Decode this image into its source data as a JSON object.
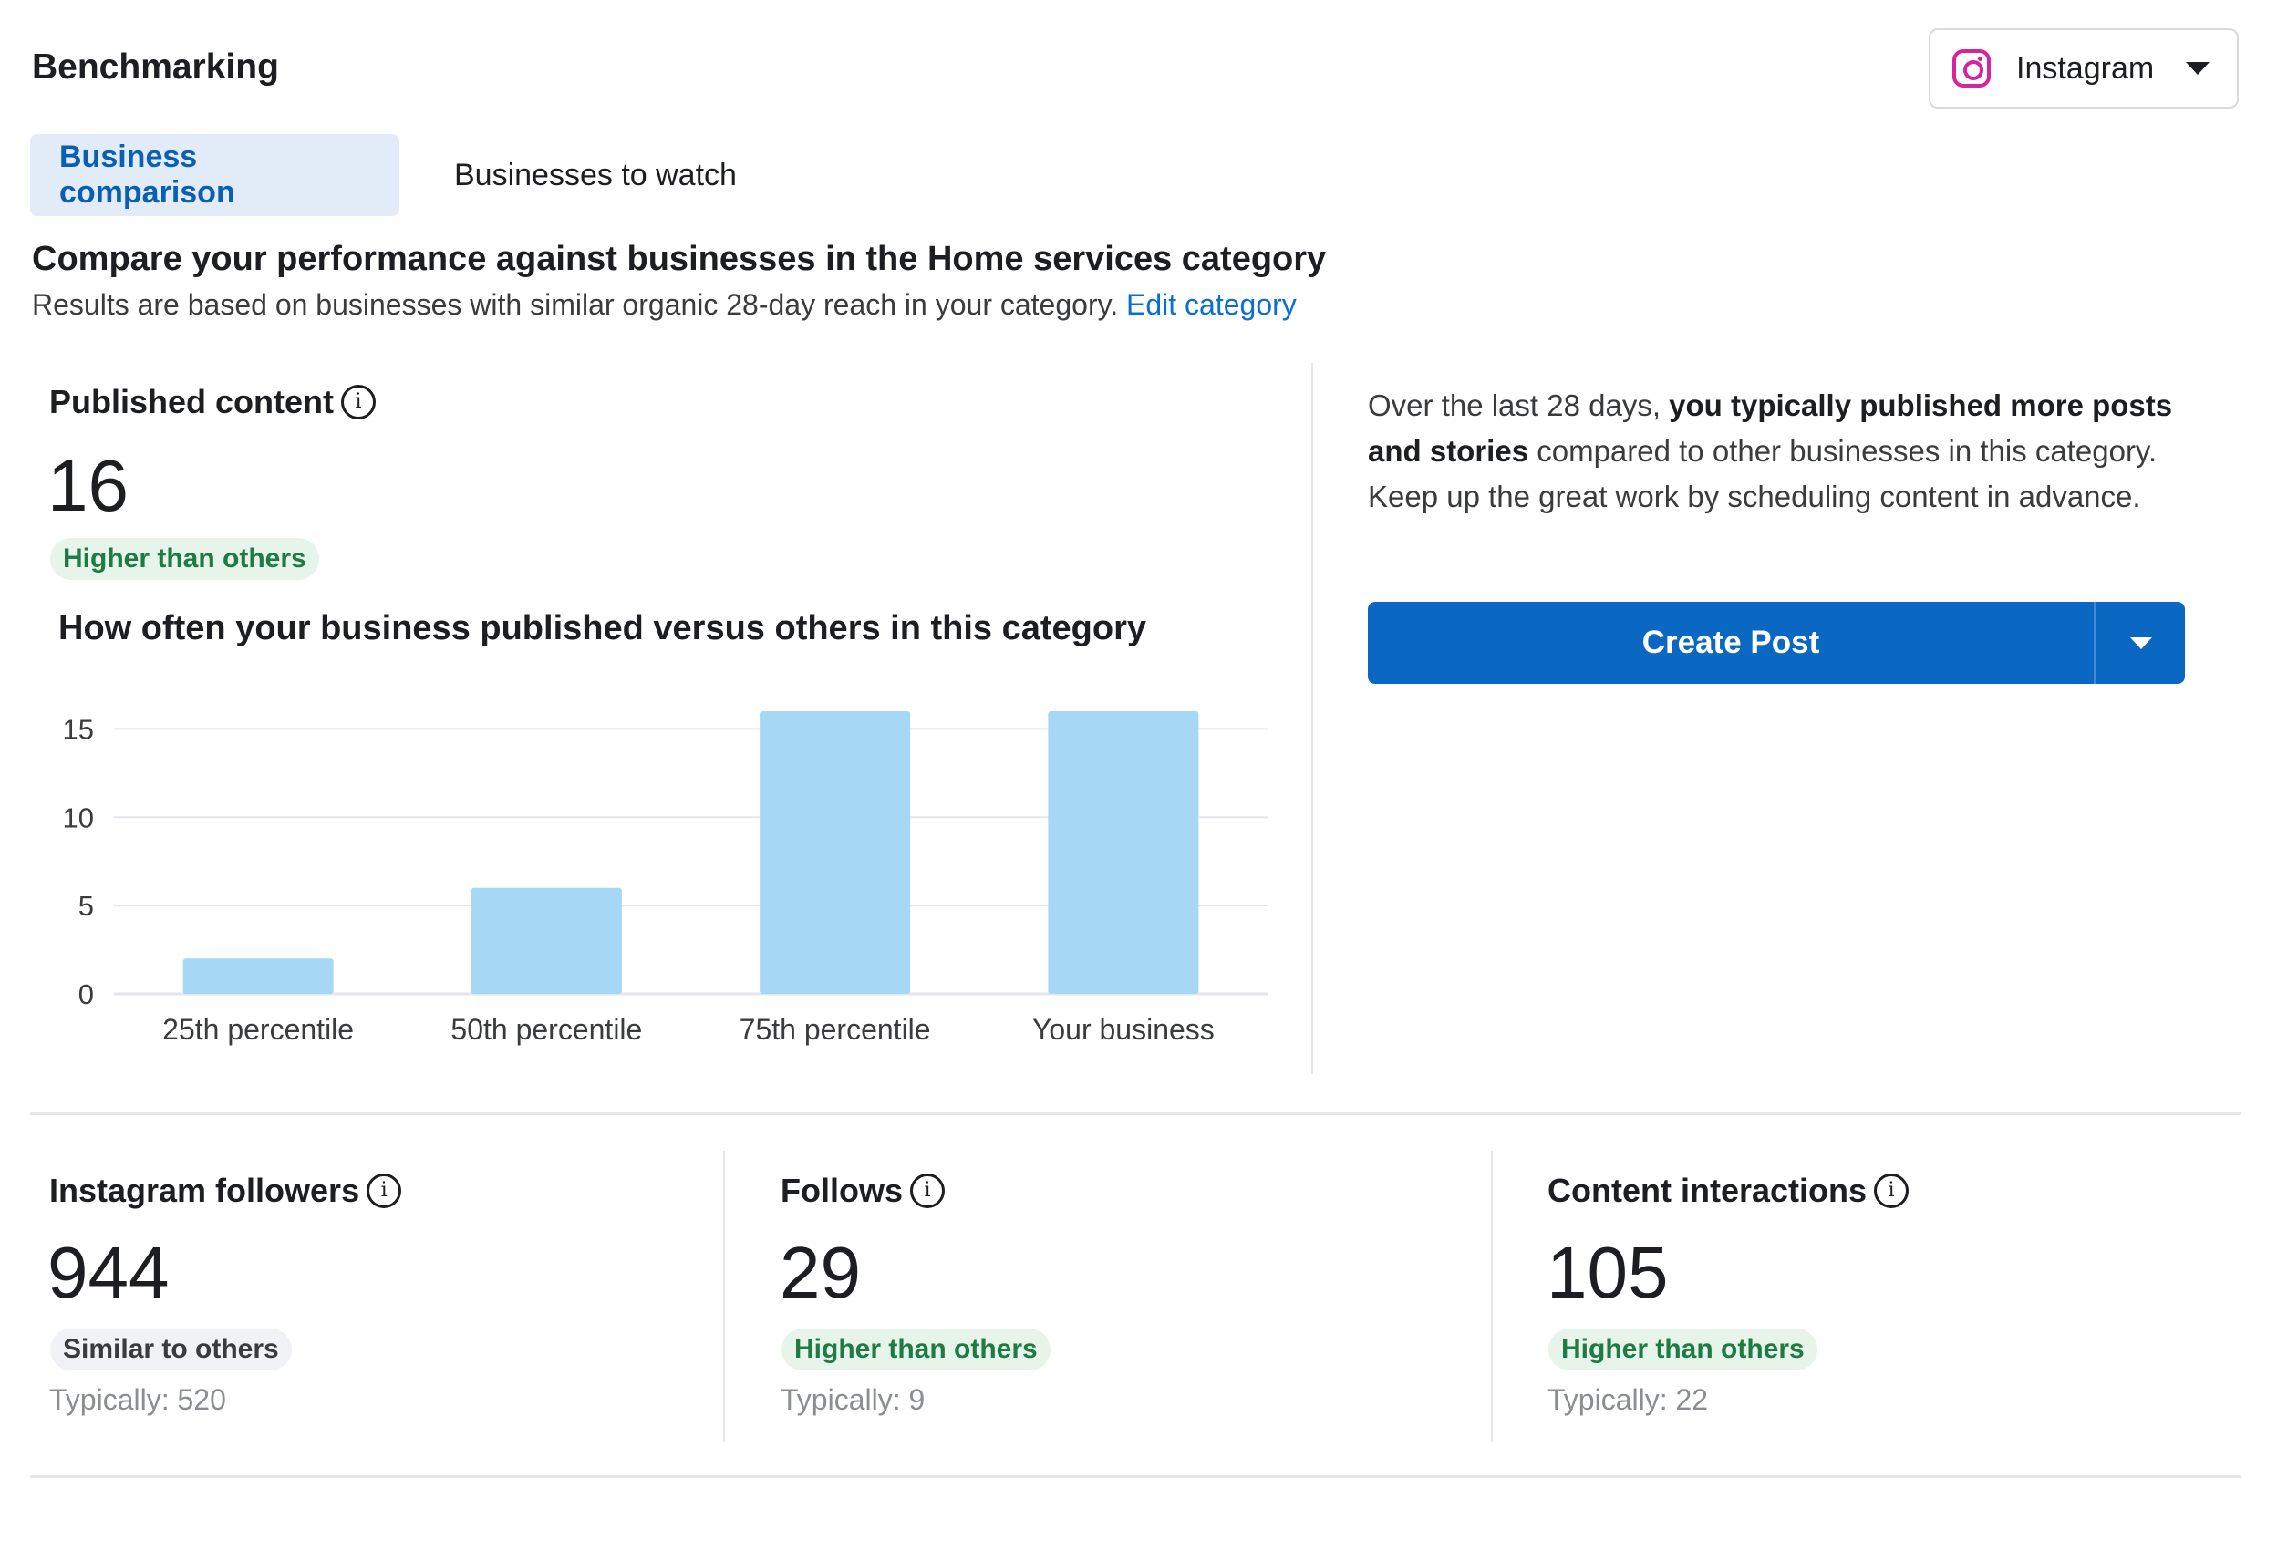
{
  "header": {
    "title": "Benchmarking",
    "platform": {
      "label": "Instagram",
      "icon": "instagram-icon"
    }
  },
  "tabs": [
    {
      "label": "Business comparison",
      "active": true
    },
    {
      "label": "Businesses to watch",
      "active": false
    }
  ],
  "compare": {
    "heading": "Compare your performance against businesses in the Home services category",
    "subtext": "Results are based on businesses with similar organic 28-day reach in your category.",
    "link": "Edit category"
  },
  "published": {
    "label": "Published content",
    "value": "16",
    "badge": "Higher than others",
    "chart_title": "How often your business published versus others in this category"
  },
  "summary": {
    "part1": "Over the last 28 days, ",
    "bold": "you typically published more posts and stories",
    "part2": " compared to other businesses in this category. Keep up the great work by scheduling content in advance.",
    "button": "Create Post"
  },
  "metrics": [
    {
      "label": "Instagram followers",
      "value": "944",
      "badge": "Similar to others",
      "tone": "gray",
      "typical": "Typically: 520"
    },
    {
      "label": "Follows",
      "value": "29",
      "badge": "Higher than others",
      "tone": "green",
      "typical": "Typically: 9"
    },
    {
      "label": "Content interactions",
      "value": "105",
      "badge": "Higher than others",
      "tone": "green",
      "typical": "Typically: 22"
    }
  ],
  "chart_data": {
    "type": "bar",
    "categories": [
      "25th percentile",
      "50th percentile",
      "75th percentile",
      "Your business"
    ],
    "values": [
      2,
      6,
      16,
      16
    ],
    "ylim": [
      0,
      16
    ],
    "yticks": [
      0,
      5,
      10,
      15
    ],
    "color": "#a6d7f5",
    "grid": true
  }
}
